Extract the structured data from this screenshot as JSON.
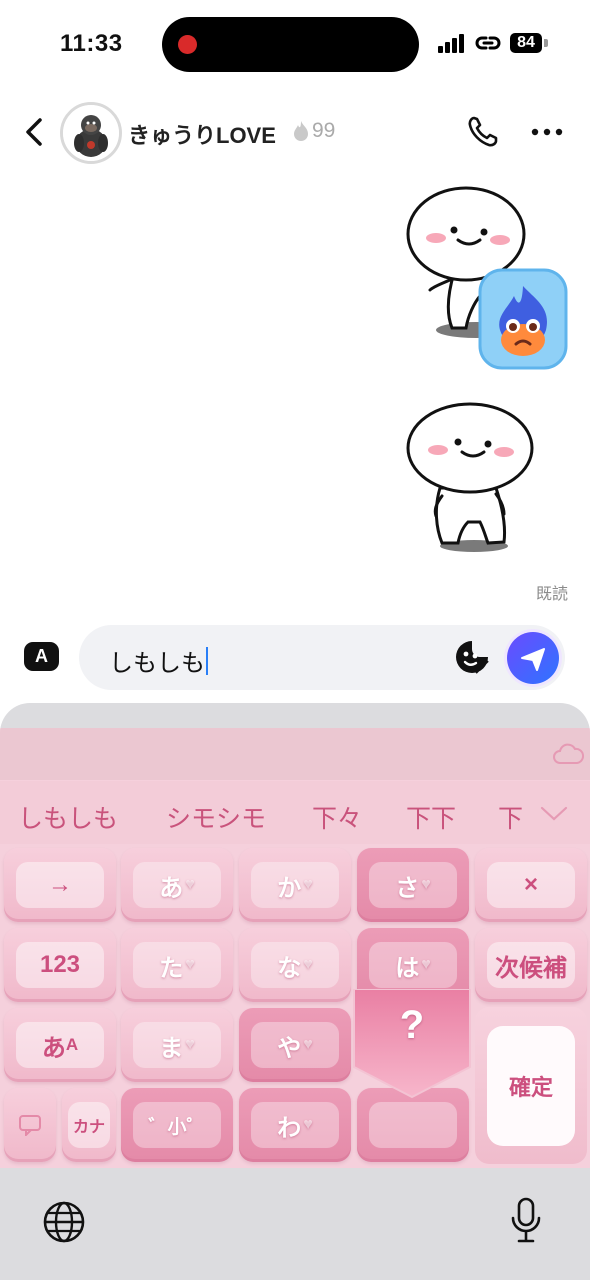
{
  "status_bar": {
    "time": "11:33",
    "battery": "84"
  },
  "header": {
    "contact_name": "きゅうりLOVE",
    "streak_count": "99"
  },
  "messages": {
    "read_receipt": "既読"
  },
  "composer": {
    "mode_label": "A",
    "text": "しもしも"
  },
  "keyboard": {
    "candidates": [
      "しもしも",
      "シモシモ",
      "下々",
      "下下",
      "下"
    ],
    "keys": {
      "arrow": "→",
      "a": "あ",
      "ka": "か",
      "sa": "さ",
      "delete": "×",
      "num": "123",
      "ta": "た",
      "na": "な",
      "ha": "は",
      "next_candidate": "次候補",
      "kana_mode_main": "あ",
      "kana_mode_sub": "A",
      "ma": "ま",
      "ya": "や",
      "popup": "?",
      "confirm": "確定",
      "katakana": "カナ",
      "dakuten": "゛小゜",
      "wa": "わ"
    }
  },
  "colors": {
    "accent": "#cc4f7e",
    "send": "#3d6bff"
  }
}
